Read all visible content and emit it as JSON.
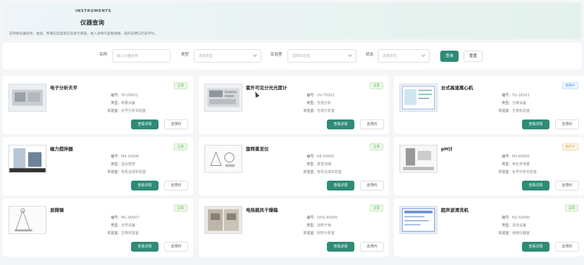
{
  "header": {
    "eyebrow": "INSTRUMENTS",
    "title": "仪器查询",
    "description": "支持按仪器名称、类型、所属实验室等信息进行筛选，进入详情可查看规格、操作说明与历史评价。"
  },
  "filter": {
    "name_label": "名称",
    "name_placeholder": "输入仪器名称",
    "type_label": "类型",
    "type_placeholder": "选择类型",
    "lab_label": "实验室",
    "lab_placeholder": "选择实验室",
    "status_label": "状态",
    "status_placeholder": "选择状态",
    "search_label": "查询",
    "reset_label": "重置"
  },
  "field_labels": {
    "code": "编号:",
    "type": "类型:",
    "lab": "实验室:"
  },
  "actions": {
    "detail": "查看详情",
    "book": "去预约"
  },
  "colors": {
    "accent": "#2e8b77",
    "status_normal": "#4caf50",
    "status_using": "#409eff",
    "status_maint": "#e6a23c"
  },
  "instruments": [
    {
      "name": "电子分析天平",
      "status": "正常",
      "status_kind": "normal",
      "code": "YP-20001",
      "type": "称量设备",
      "lab": "化学分析实验室"
    },
    {
      "name": "紫外可见分光光度计",
      "status": "正常",
      "status_kind": "normal",
      "code": "UV-75002",
      "type": "光谱分析",
      "lab": "光谱分析室"
    },
    {
      "name": "台式高速离心机",
      "status": "使用中",
      "status_kind": "using",
      "code": "TG-16503",
      "type": "分离设备",
      "lab": "生物实验室"
    },
    {
      "name": "磁力搅拌器",
      "status": "正常",
      "status_kind": "normal",
      "code": "MS-10006",
      "type": "混合搅拌",
      "lab": "有机合成实验室"
    },
    {
      "name": "旋转蒸发仪",
      "status": "正常",
      "status_kind": "normal",
      "code": "RE-50005",
      "type": "蒸发浓缩",
      "lab": "有机合成实验室"
    },
    {
      "name": "pH计",
      "status": "维护中",
      "status_kind": "maint",
      "code": "PH-60000",
      "type": "电化学测量",
      "lab": "化学分析实验室"
    },
    {
      "name": "显微镜",
      "status": "正常",
      "status_kind": "normal",
      "code": "MC-90007",
      "type": "光学设备",
      "lab": "生物实验室"
    },
    {
      "name": "电热鼓风干燥箱",
      "status": "正常",
      "status_kind": "normal",
      "code": "DHG-90005",
      "type": "加热干燥",
      "lab": "材料分析室"
    },
    {
      "name": "超声波清洗机",
      "status": "正常",
      "status_kind": "normal",
      "code": "KQ-50000",
      "type": "清洗设备",
      "lab": "通用仪器室"
    }
  ]
}
